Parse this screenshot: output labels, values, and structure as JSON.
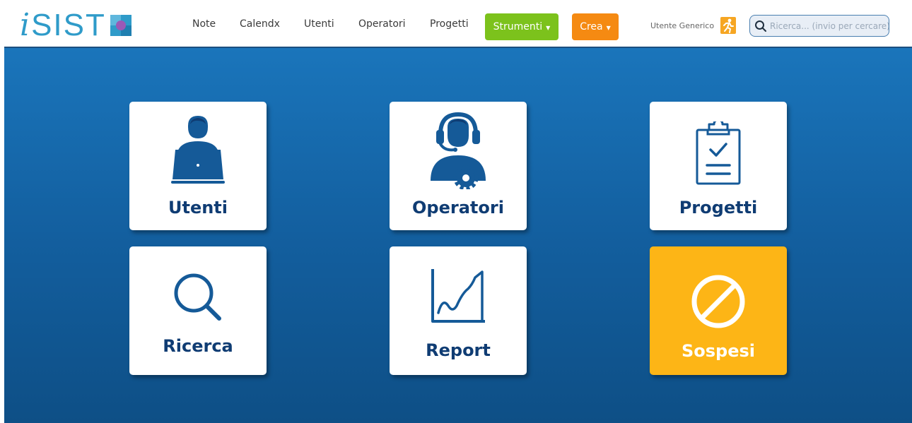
{
  "logo": {
    "i": "i",
    "text": "SIST"
  },
  "nav": {
    "links": [
      "Note",
      "Calendx",
      "Utenti",
      "Operatori",
      "Progetti"
    ],
    "strumenti": "Strumenti",
    "crea": "Crea",
    "user_name": "Utente Generico"
  },
  "search": {
    "placeholder": "Ricerca... (invio per cercare)"
  },
  "tiles": {
    "utenti": {
      "label": "Utenti",
      "icon": "user-laptop-icon"
    },
    "operatori": {
      "label": "Operatori",
      "icon": "operator-headset-icon"
    },
    "progetti": {
      "label": "Progetti",
      "icon": "clipboard-check-icon"
    },
    "ricerca": {
      "label": "Ricerca",
      "icon": "search-icon"
    },
    "report": {
      "label": "Report",
      "icon": "chart-icon"
    },
    "sospesi": {
      "label": "Sospesi",
      "icon": "prohibited-icon"
    }
  },
  "colors": {
    "brand_blue": "#2f9bc9",
    "navy": "#0f3c73",
    "strumenti_green": "#7cc21c",
    "crea_orange": "#f58a12",
    "sospesi_yellow": "#fdb516",
    "background_blue": "#1a75bb"
  }
}
